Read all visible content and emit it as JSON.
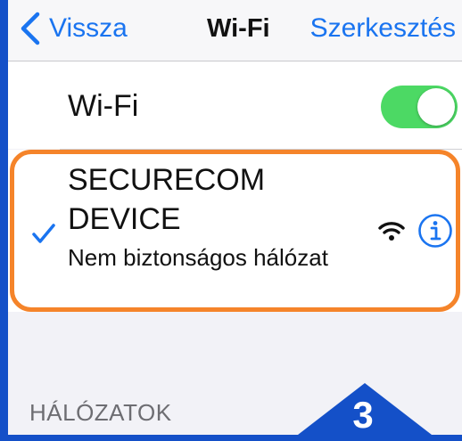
{
  "navbar": {
    "back_label": "Vissza",
    "title": "Wi-Fi",
    "edit_label": "Szerkesztés"
  },
  "wifi_toggle": {
    "label": "Wi-Fi",
    "state": "on",
    "color": "#4cd964"
  },
  "connected_network": {
    "name": "SECURECOM DEVICE",
    "status": "Nem biztonságos hálózat",
    "selected": true,
    "signal_icon": "wifi-icon",
    "info_icon": "info-icon"
  },
  "networks_section": {
    "header": "HÁLÓZATOK"
  },
  "step_badge": {
    "number": "3"
  },
  "colors": {
    "accent": "#1a74f0",
    "highlight_border": "#f5842a",
    "frame": "#1450c8"
  }
}
